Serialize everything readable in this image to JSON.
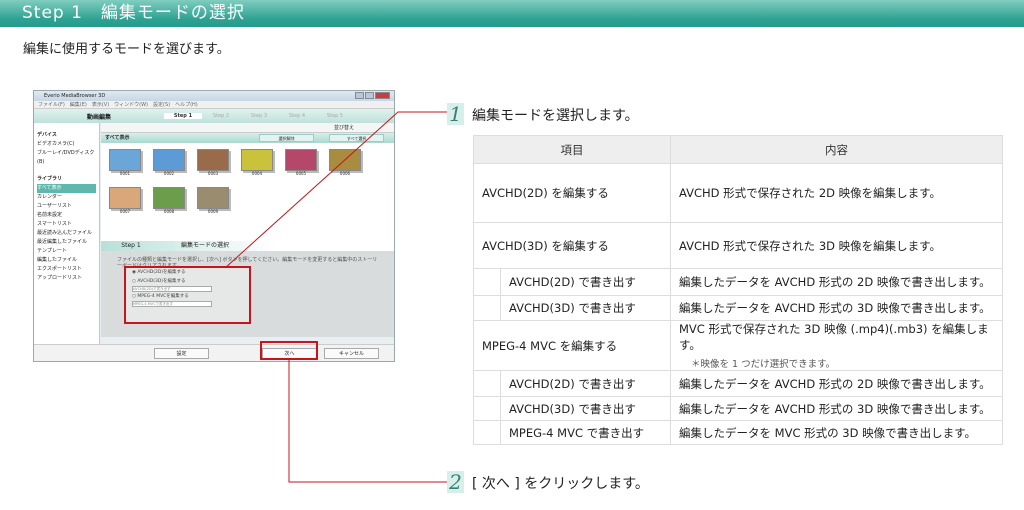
{
  "header": {
    "title": "Step 1　編集モードの選択"
  },
  "intro": "編集に使用するモードを選びます。",
  "screenshot": {
    "window_title": "Everio MediaBrowser 3D",
    "menu": "ファイル(F)　編集(E)　表示(V)　ウィンドウ(W)　設定(S)　ヘルプ(H)",
    "section": "動画編集",
    "steps": [
      "Step 1",
      "Step 2",
      "Step 3",
      "Step 4",
      "Step 5"
    ],
    "sidebar": {
      "device_header": "デバイス",
      "devices": [
        "ビデオカメラ(C)",
        "ブルーレイ/DVDディスク(B)"
      ],
      "library_header": "ライブラリ",
      "library": [
        "すべて表示",
        "カレンダー",
        "ユーザーリスト",
        "名前未設定",
        "スマートリスト",
        "最近読み込んだファイル",
        "最近編集したファイル",
        "テンプレート",
        "編集したファイル",
        "エクスポートリスト",
        "アップロードリスト"
      ]
    },
    "all_label": "すべて表示",
    "toolbar_buttons": [
      "選択解除",
      "すべて選択"
    ],
    "sort_label": "並び替え",
    "thumbnails": [
      "0001",
      "0002",
      "0003",
      "0004",
      "0005",
      "0006",
      "0007",
      "0008",
      "0009"
    ],
    "thumb_colors": [
      "#6aa7d8",
      "#5d9bd6",
      "#9a6b4b",
      "#c9c23a",
      "#b5486a",
      "#a88c3f",
      "#d9a77a",
      "#6c9d4a",
      "#9a8d6f"
    ],
    "lower_step": "Step 1",
    "lower_title": "編集モードの選択",
    "message": "ファイルの種類と編集モードを選択し、[次へ] ボタンを押してください。編集モードを変更すると編集中のストーリーボードはクリアされます。",
    "options": [
      "AVCHD(2D)を編集する",
      "AVCHD(3D)を編集する",
      "AVCHD(2D)で書き出す",
      "MPEG-4 MVCを編集する",
      "MPEG-4 MVCで書き出す"
    ],
    "buttons": {
      "settings": "設定",
      "next": "次へ",
      "cancel": "キャンセル"
    }
  },
  "steps": [
    {
      "num": "1",
      "text": "編集モードを選択します。"
    },
    {
      "num": "2",
      "text": "[ 次へ ] をクリックします。"
    }
  ],
  "table": {
    "headers": [
      "項目",
      "内容"
    ],
    "rows": [
      {
        "item": "AVCHD(2D) を編集する",
        "desc": "AVCHD 形式で保存された 2D 映像を編集します。"
      },
      {
        "item": "AVCHD(3D) を編集する",
        "desc": "AVCHD 形式で保存された 3D 映像を編集します。"
      },
      {
        "item": "AVCHD(2D) で書き出す",
        "desc": "編集したデータを AVCHD 形式の 2D 映像で書き出します。"
      },
      {
        "item": "AVCHD(3D) で書き出す",
        "desc": "編集したデータを AVCHD 形式の 3D 映像で書き出します。"
      },
      {
        "item": "MPEG-4 MVC を編集する",
        "desc": "MVC 形式で保存された 3D 映像 (.mp4)(.mb3) を編集します。",
        "note": "＊映像を 1 つだけ選択できます。"
      },
      {
        "item": "AVCHD(2D) で書き出す",
        "desc": "編集したデータを AVCHD 形式の 2D 映像で書き出します。"
      },
      {
        "item": "AVCHD(3D) で書き出す",
        "desc": "編集したデータを AVCHD 形式の 3D 映像で書き出します。"
      },
      {
        "item": "MPEG-4 MVC で書き出す",
        "desc": "編集したデータを MVC 形式の 3D 映像で書き出します。"
      }
    ]
  },
  "colors": {
    "accent": "#2fa393",
    "highlight": "#c4161c"
  }
}
